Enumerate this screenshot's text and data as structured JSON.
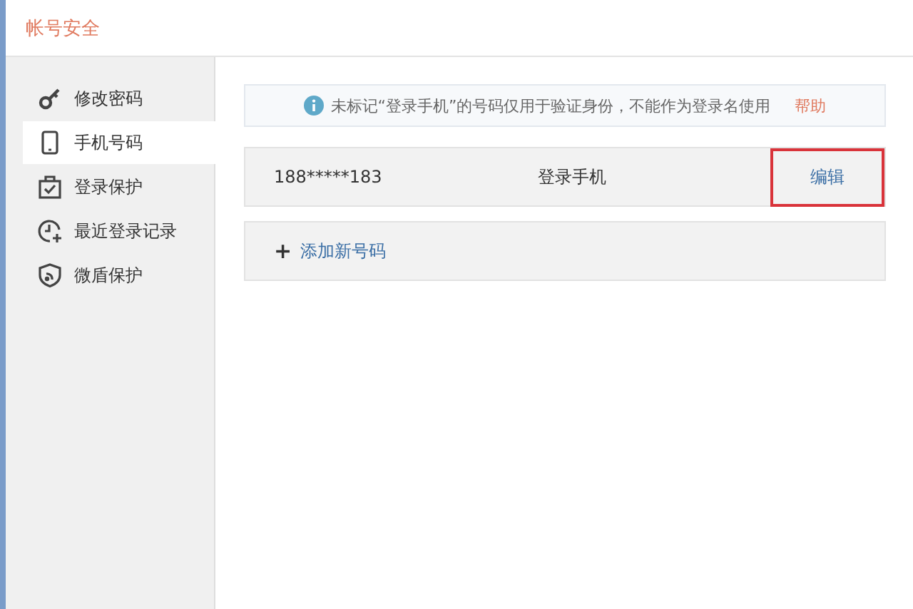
{
  "header": {
    "title": "帐号安全"
  },
  "sidebar": {
    "items": [
      {
        "label": "修改密码",
        "selected": false
      },
      {
        "label": "手机号码",
        "selected": true
      },
      {
        "label": "登录保护",
        "selected": false
      },
      {
        "label": "最近登录记录",
        "selected": false
      },
      {
        "label": "微盾保护",
        "selected": false
      }
    ]
  },
  "notice": {
    "text": "未标记“登录手机”的号码仅用于验证身份，不能作为登录名使用",
    "link": "帮助"
  },
  "phones": [
    {
      "number": "188*****183",
      "tag": "登录手机",
      "action": "编辑",
      "highlighted": true
    }
  ],
  "add_button": {
    "icon": "+",
    "label": "添加新号码"
  }
}
